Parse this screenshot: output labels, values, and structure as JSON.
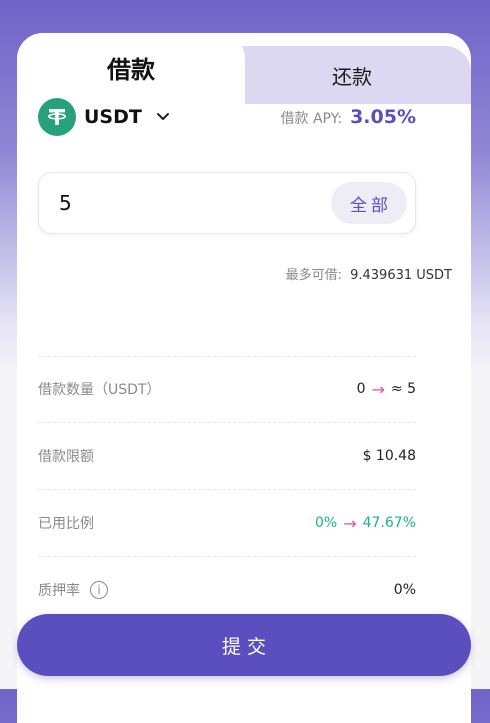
{
  "tabs": {
    "borrow": "借款",
    "repay": "还款"
  },
  "asset": {
    "name": "USDT",
    "icon": "tether-icon"
  },
  "apy": {
    "label": "借款 APY:",
    "value": "3.05%"
  },
  "amount": {
    "value": "5",
    "all_label": "全部"
  },
  "max_borrow": {
    "label": "最多可借:",
    "value": "9.439631 USDT"
  },
  "info": {
    "amount": {
      "label": "借款数量（USDT）",
      "from": "0",
      "to": "≈ 5"
    },
    "limit": {
      "label": "借款限额",
      "value": "$ 10.48"
    },
    "ratio": {
      "label": "已用比例",
      "from": "0%",
      "to": "47.67%"
    },
    "collateral": {
      "label": "质押率",
      "value": "0%"
    }
  },
  "submit_label": "提交",
  "colors": {
    "accent": "#5b4fbf",
    "green": "#19b38c",
    "pink": "#e64d9a",
    "tether": "#26a17b"
  }
}
